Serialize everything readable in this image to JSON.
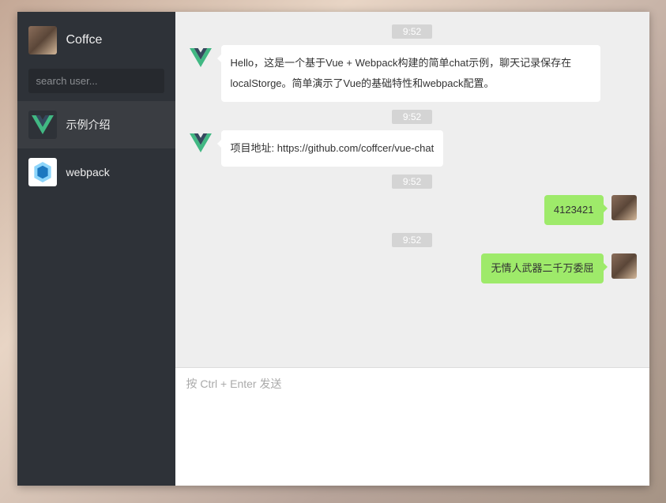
{
  "user": {
    "name": "Coffce"
  },
  "search": {
    "placeholder": "search user..."
  },
  "contacts": [
    {
      "id": "intro",
      "label": "示例介绍",
      "icon": "vue",
      "active": true
    },
    {
      "id": "webpack",
      "label": "webpack",
      "icon": "webpack",
      "active": false
    }
  ],
  "messages": [
    {
      "time": "9:52",
      "self": false,
      "avatar": "vue",
      "text": "Hello，这是一个基于Vue + Webpack构建的简单chat示例，聊天记录保存在localStorge。简单演示了Vue的基础特性和webpack配置。"
    },
    {
      "time": "9:52",
      "self": false,
      "avatar": "vue",
      "text": "项目地址: https://github.com/coffcer/vue-chat"
    },
    {
      "time": "9:52",
      "self": true,
      "avatar": "coffce",
      "text": "4123421"
    },
    {
      "time": "9:52",
      "self": true,
      "avatar": "coffce",
      "text": "无情人武器二千万委屈"
    }
  ],
  "input": {
    "placeholder": "按 Ctrl + Enter 发送"
  },
  "colors": {
    "sidebar": "#2e3238",
    "bubbleSelf": "#9eea6a",
    "bubbleOther": "#ffffff"
  }
}
